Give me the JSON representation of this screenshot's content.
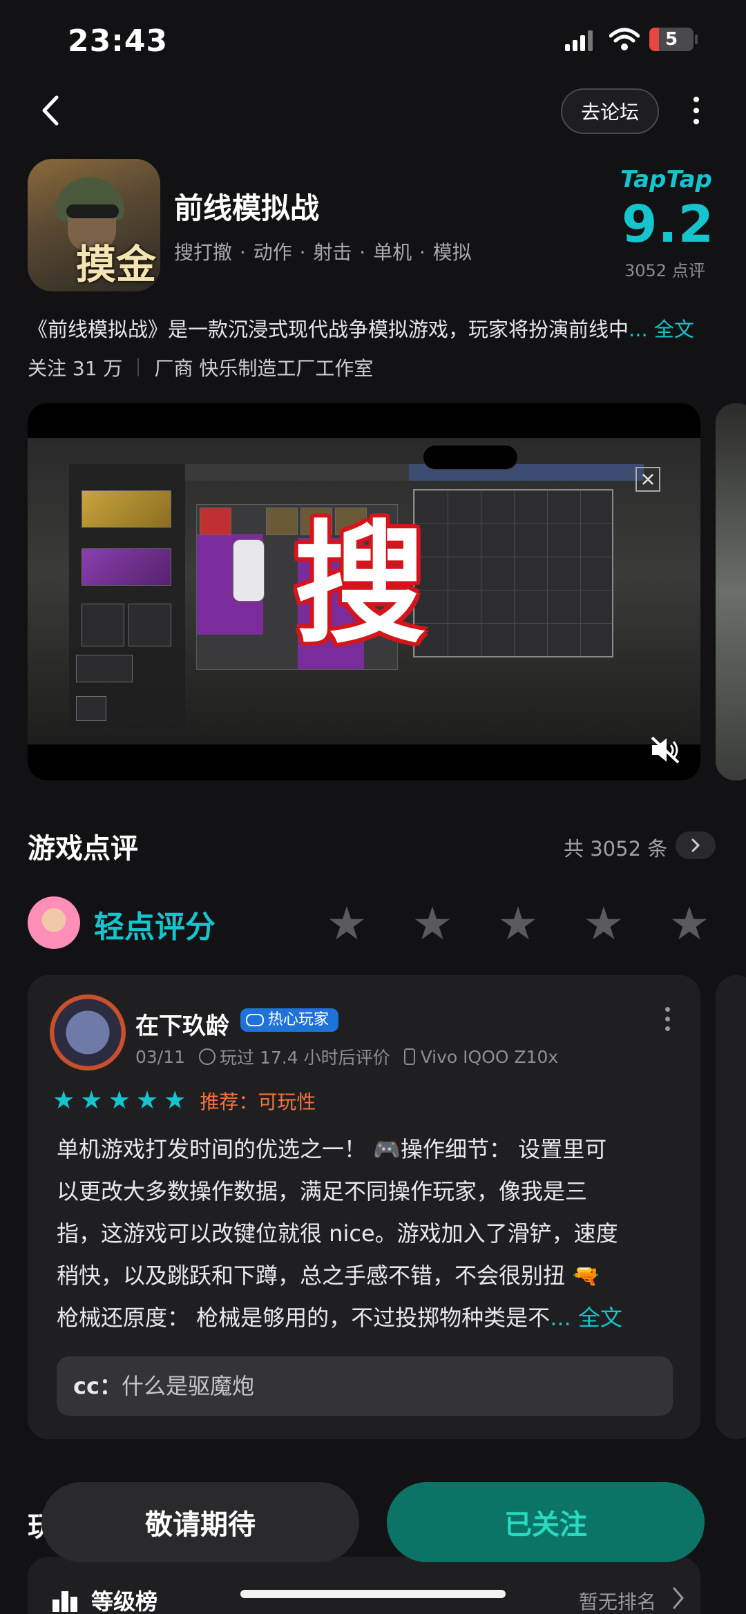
{
  "status_bar": {
    "time": "23:43",
    "battery": "5"
  },
  "nav": {
    "forum_label": "去论坛"
  },
  "game": {
    "icon_text": "摸金",
    "title": "前线模拟战",
    "tags": "搜打撤 · 动作 · 射击 · 单机 · 模拟",
    "brand": "TapTap",
    "score": "9.2",
    "rating_count": "3052 点评",
    "description": "《前线模拟战》是一款沉浸式现代战争模拟游戏，玩家将扮演前线中",
    "description_more": "... 全文",
    "followers": "关注 31 万",
    "developer": "厂商 快乐制造工厂工作室"
  },
  "media": {
    "overlay_text": "搜"
  },
  "reviews": {
    "section_title": "游戏点评",
    "total": "共 3052 条",
    "rate_label": "轻点评分",
    "rating_stars": 0,
    "card": {
      "user": "在下玖龄",
      "badge": "热心玩家",
      "date": "03/11",
      "playtime": "玩过 17.4 小时后评价",
      "device": "Vivo IQOO Z10x",
      "stars": 5,
      "recommend": "推荐：可玩性",
      "lines": [
        "单机游戏打发时间的优选之一！ 🎮操作细节： 设置里可",
        "以更改大多数操作数据，满足不同操作玩家，像我是三",
        "指，这游戏可以改键位就很 nice。游戏加入了滑铲，速度",
        "稍快，以及跳跃和下蹲，总之手感不错，不会很别扭 🔫",
        "枪械还原度： 枪械是够用的，不过投掷物种类是不"
      ],
      "more": "... 全文",
      "reply_user": "cc：",
      "reply_text": "什么是驱魔炮"
    }
  },
  "bottom": {
    "partial_heading": "玩",
    "rank_label": "等级榜",
    "rank_value": "暂无排名",
    "wish_button": "敬请期待",
    "follow_button": "已关注"
  },
  "colors": {
    "accent": "#15c5ce",
    "follow_bg": "#0b7466",
    "recommend": "#f5733d",
    "background": "#121214"
  }
}
